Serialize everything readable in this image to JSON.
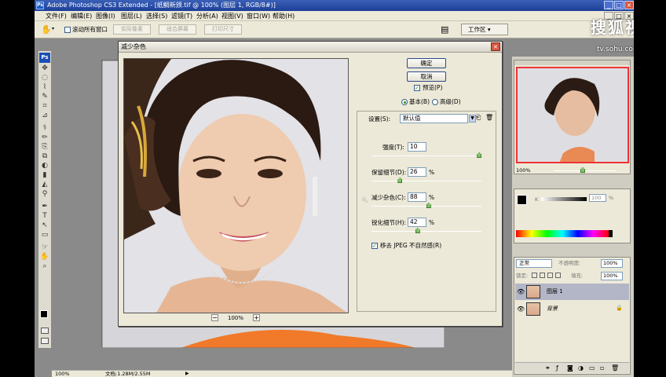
{
  "app": {
    "title": "Adobe Photoshop CS3 Extended - [纸鲷新颁.tif @ 100% (图层 1, RGB/8#)]",
    "icon_label": "Ps",
    "window_controls": [
      "_",
      "□",
      "×"
    ],
    "doc_window_controls": [
      "_",
      "□",
      "×"
    ]
  },
  "menu": [
    "文件(F)",
    "编辑(E)",
    "图像(I)",
    "图层(L)",
    "选择(S)",
    "滤镜(T)",
    "分析(A)",
    "视图(V)",
    "窗口(W)",
    "帮助(H)"
  ],
  "options_bar": {
    "scroll_all_label": "滚动所有窗口",
    "scroll_all_checked": false,
    "buttons": [
      "实际像素",
      "适合屏幕",
      "打印尺寸"
    ],
    "workspace_label": "工作区 ▾"
  },
  "tools": {
    "logo": "Ps",
    "glyphs": [
      "✥",
      "◌",
      "⌇",
      "✎",
      "⌗",
      "⊿",
      "⚕",
      "✏",
      "⎘",
      "⧉",
      "◐",
      "▮",
      "◭",
      "⚲",
      "✒",
      "T",
      "↖",
      "▭",
      "☞",
      "✋",
      "⌕"
    ]
  },
  "status": {
    "zoom": "100%",
    "doc": "文档:1.28M/2.55M"
  },
  "navigator": {
    "zoom": "100%"
  },
  "color_panel": {
    "channel": "K",
    "value": "100"
  },
  "layers_panel": {
    "blend_mode": "正常",
    "opacity_label": "不透明度:",
    "opacity": "100%",
    "lock_label": "锁定:",
    "fill_label": "填充:",
    "fill": "100%",
    "layers": [
      {
        "name": "图层 1",
        "visible": true,
        "selected": true
      },
      {
        "name": "背景",
        "visible": true,
        "selected": false
      }
    ],
    "lock_icon": "🔒"
  },
  "dialog": {
    "title": "减少杂色",
    "close": "×",
    "ok": "确定",
    "cancel": "取消",
    "preview_label": "预览(P)",
    "preview_checked": true,
    "mode_basic": "基本(B)",
    "mode_advanced": "高级(D)",
    "settings_label": "设置(S):",
    "settings_value": "默认值",
    "strength_label": "强度(T):",
    "strength": "10",
    "preserve_label": "保留细节(D):",
    "preserve": "26",
    "reduce_label": "减少杂色(C):",
    "reduce": "88",
    "sharpen_label": "锐化细节(H):",
    "sharpen": "42",
    "percent": "%",
    "remove_jpeg_label": "移去 JPEG 不自然感(R)",
    "remove_jpeg_checked": true,
    "zoom": "100%",
    "zoom_out": "−",
    "zoom_in": "+",
    "sliders": {
      "strength": 0.98,
      "preserve": 0.26,
      "reduce": 0.52,
      "sharpen": 0.42
    }
  },
  "watermark": {
    "text": "搜狐视频",
    "url": "tv.sohu.com"
  },
  "colors": {
    "title_bar": "#2a4fa8",
    "chrome": "#ece9d8",
    "workspace_bg": "#8a8a8a",
    "close_button": "#d8553f",
    "slider_knob": "#7fc46a",
    "layer_selected": "#b3b6c6"
  }
}
